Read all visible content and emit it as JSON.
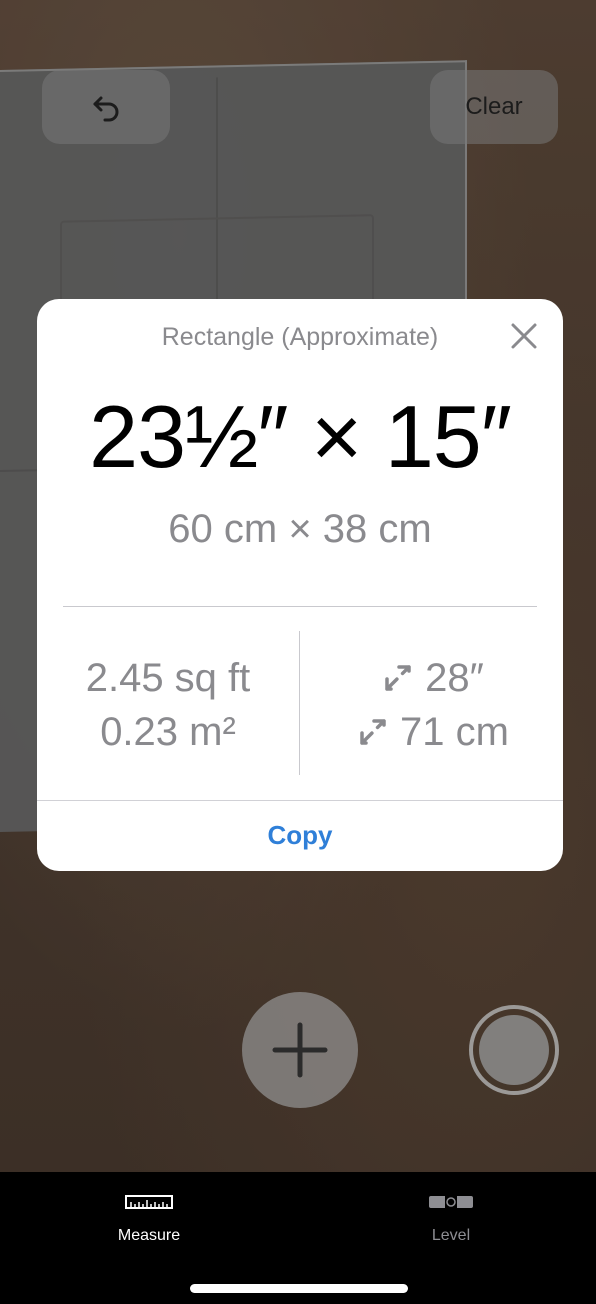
{
  "toolbar": {
    "clear_label": "Clear",
    "undo_icon": "undo-arrow-icon"
  },
  "measurement_card": {
    "title": "Rectangle (Approximate)",
    "dimensions_imperial": "23½″ × 15″",
    "dimensions_metric": "60 cm × 38 cm",
    "area_imperial": "2.45 sq ft",
    "area_metric": "0.23 m²",
    "diagonal_imperial": "28″",
    "diagonal_metric": "71 cm",
    "copy_label": "Copy",
    "accent_color": "#2f7fd8"
  },
  "tabbar": {
    "tabs": [
      {
        "label": "Measure",
        "icon": "ruler-icon",
        "selected": true
      },
      {
        "label": "Level",
        "icon": "level-icon",
        "selected": false
      }
    ]
  }
}
